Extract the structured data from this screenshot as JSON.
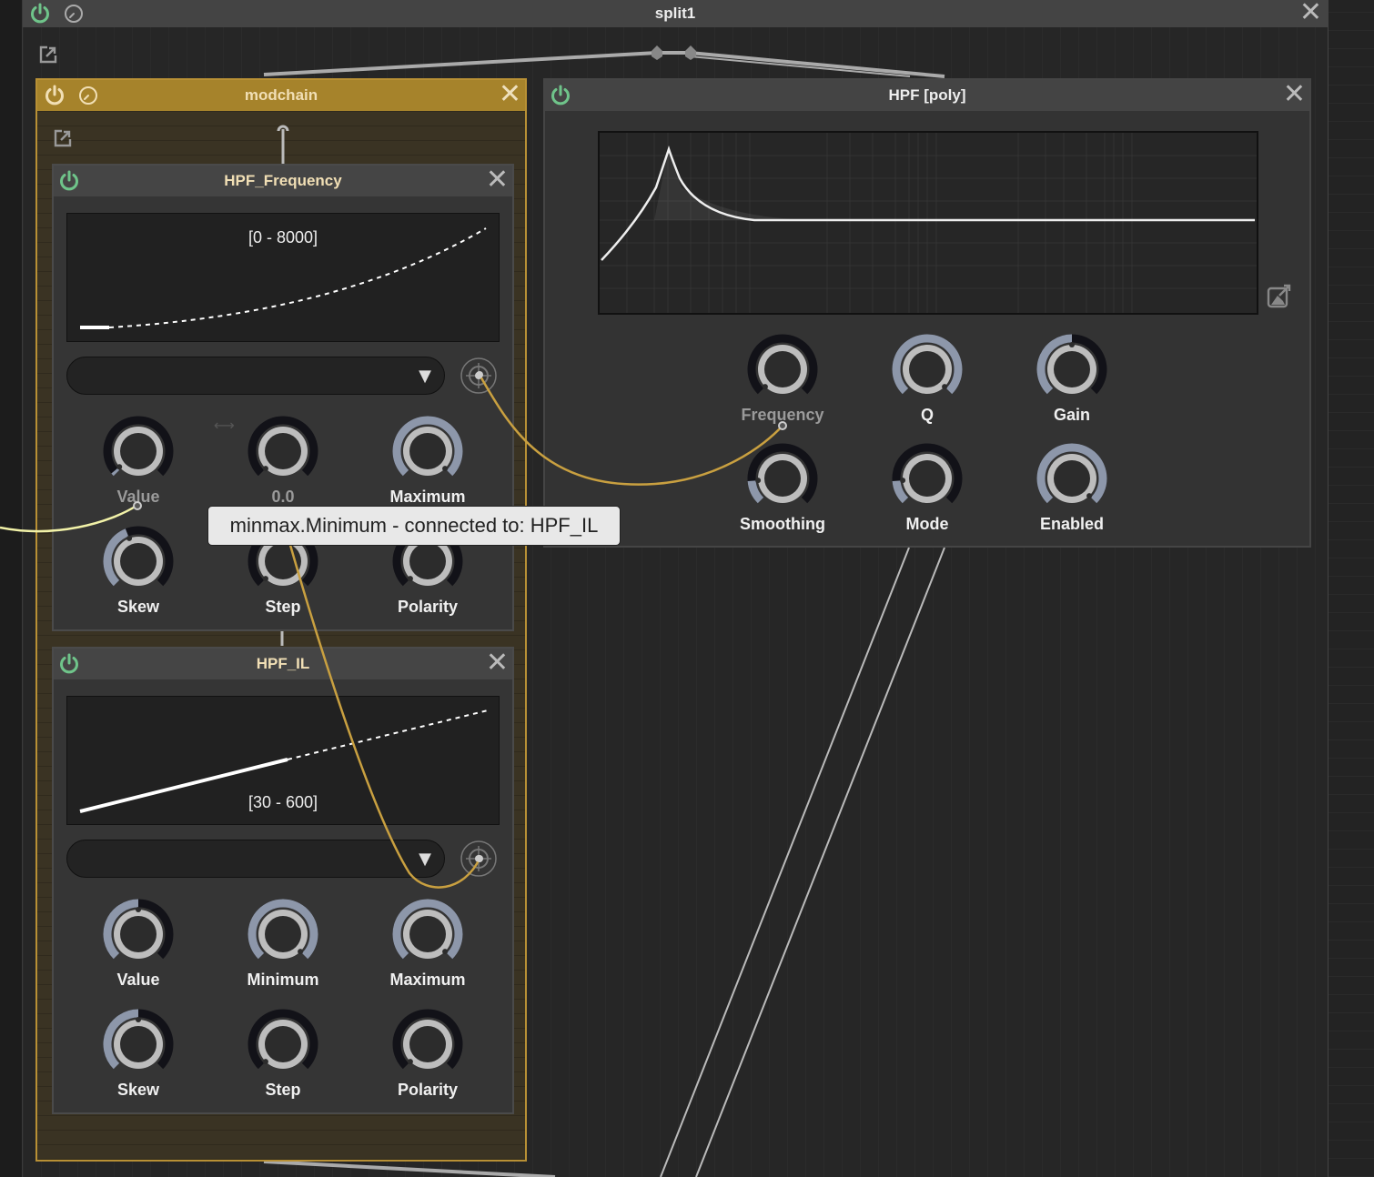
{
  "split": {
    "title": "split1",
    "icons": [
      "power-icon",
      "clock-icon",
      "close-icon",
      "popout-icon"
    ]
  },
  "modchain": {
    "title": "modchain",
    "accent_color": "#a6832b",
    "modulators": [
      {
        "title": "HPF_Frequency",
        "range": "[0 - 8000]",
        "dropdown_value": "",
        "knobs": [
          {
            "label": "Value",
            "dimmed": true,
            "value": 0.02
          },
          {
            "label": "0.0",
            "dimmed": true,
            "value": 0.0
          },
          {
            "label": "Maximum",
            "dimmed": false,
            "value": 1.0
          },
          {
            "label": "Skew",
            "dimmed": false,
            "value": 0.42
          },
          {
            "label": "Step",
            "dimmed": false,
            "value": 0.0
          },
          {
            "label": "Polarity",
            "dimmed": false,
            "value": 0.0
          }
        ]
      },
      {
        "title": "HPF_IL",
        "range": "[30 - 600]",
        "dropdown_value": "",
        "knobs": [
          {
            "label": "Value",
            "dimmed": false,
            "value": 0.5
          },
          {
            "label": "Minimum",
            "dimmed": false,
            "value": 1.0
          },
          {
            "label": "Maximum",
            "dimmed": false,
            "value": 1.0
          },
          {
            "label": "Skew",
            "dimmed": false,
            "value": 0.5
          },
          {
            "label": "Step",
            "dimmed": false,
            "value": 0.0
          },
          {
            "label": "Polarity",
            "dimmed": false,
            "value": 0.0
          }
        ]
      }
    ]
  },
  "hpf": {
    "title": "HPF [poly]",
    "knobs": [
      {
        "label": "Frequency",
        "dimmed": true,
        "value": 0.0
      },
      {
        "label": "Q",
        "dimmed": false,
        "value": 1.0
      },
      {
        "label": "Gain",
        "dimmed": false,
        "value": 0.5
      },
      {
        "label": "Smoothing",
        "dimmed": false,
        "value": 0.15
      },
      {
        "label": "Mode",
        "dimmed": false,
        "value": 0.15
      },
      {
        "label": "Enabled",
        "dimmed": false,
        "value": 1.0
      }
    ]
  },
  "tooltip": {
    "text": "minmax.Minimum - connected to: HPF_IL"
  },
  "colors": {
    "power_on": "#6fc48a",
    "cable_mod": "#c9a040",
    "cable_yellow": "#f2f2a8",
    "knob_arc_active": "#8d97aa",
    "knob_arc_track": "#121218"
  }
}
